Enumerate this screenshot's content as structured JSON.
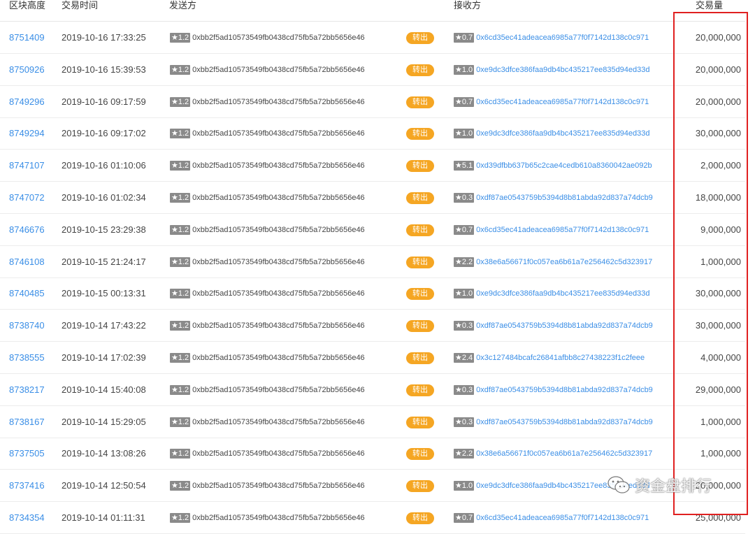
{
  "columns": {
    "height": "区块高度",
    "time": "交易时间",
    "from": "发送方",
    "to": "接收方",
    "amount": "交易量"
  },
  "rows": [
    {
      "height": "8751409",
      "time": "2019-10-16 17:33:25",
      "from_score": "★1.2",
      "from": "0xbb2f5ad10573549fb0438cd75fb5a72bb5656e46",
      "direction": "转出",
      "to_score": "★0.7",
      "to": "0x6cd35ec41adeacea6985a77f0f7142d138c0c971",
      "amount": "20,000,000"
    },
    {
      "height": "8750926",
      "time": "2019-10-16 15:39:53",
      "from_score": "★1.2",
      "from": "0xbb2f5ad10573549fb0438cd75fb5a72bb5656e46",
      "direction": "转出",
      "to_score": "★1.0",
      "to": "0xe9dc3dfce386faa9db4bc435217ee835d94ed33d",
      "amount": "20,000,000"
    },
    {
      "height": "8749296",
      "time": "2019-10-16 09:17:59",
      "from_score": "★1.2",
      "from": "0xbb2f5ad10573549fb0438cd75fb5a72bb5656e46",
      "direction": "转出",
      "to_score": "★0.7",
      "to": "0x6cd35ec41adeacea6985a77f0f7142d138c0c971",
      "amount": "20,000,000"
    },
    {
      "height": "8749294",
      "time": "2019-10-16 09:17:02",
      "from_score": "★1.2",
      "from": "0xbb2f5ad10573549fb0438cd75fb5a72bb5656e46",
      "direction": "转出",
      "to_score": "★1.0",
      "to": "0xe9dc3dfce386faa9db4bc435217ee835d94ed33d",
      "amount": "30,000,000"
    },
    {
      "height": "8747107",
      "time": "2019-10-16 01:10:06",
      "from_score": "★1.2",
      "from": "0xbb2f5ad10573549fb0438cd75fb5a72bb5656e46",
      "direction": "转出",
      "to_score": "★5.1",
      "to": "0xd39dfbb637b65c2cae4cedb610a8360042ae092b",
      "amount": "2,000,000"
    },
    {
      "height": "8747072",
      "time": "2019-10-16 01:02:34",
      "from_score": "★1.2",
      "from": "0xbb2f5ad10573549fb0438cd75fb5a72bb5656e46",
      "direction": "转出",
      "to_score": "★0.3",
      "to": "0xdf87ae0543759b5394d8b81abda92d837a74dcb9",
      "amount": "18,000,000"
    },
    {
      "height": "8746676",
      "time": "2019-10-15 23:29:38",
      "from_score": "★1.2",
      "from": "0xbb2f5ad10573549fb0438cd75fb5a72bb5656e46",
      "direction": "转出",
      "to_score": "★0.7",
      "to": "0x6cd35ec41adeacea6985a77f0f7142d138c0c971",
      "amount": "9,000,000"
    },
    {
      "height": "8746108",
      "time": "2019-10-15 21:24:17",
      "from_score": "★1.2",
      "from": "0xbb2f5ad10573549fb0438cd75fb5a72bb5656e46",
      "direction": "转出",
      "to_score": "★2.2",
      "to": "0x38e6a56671f0c057ea6b61a7e256462c5d323917",
      "amount": "1,000,000"
    },
    {
      "height": "8740485",
      "time": "2019-10-15 00:13:31",
      "from_score": "★1.2",
      "from": "0xbb2f5ad10573549fb0438cd75fb5a72bb5656e46",
      "direction": "转出",
      "to_score": "★1.0",
      "to": "0xe9dc3dfce386faa9db4bc435217ee835d94ed33d",
      "amount": "30,000,000"
    },
    {
      "height": "8738740",
      "time": "2019-10-14 17:43:22",
      "from_score": "★1.2",
      "from": "0xbb2f5ad10573549fb0438cd75fb5a72bb5656e46",
      "direction": "转出",
      "to_score": "★0.3",
      "to": "0xdf87ae0543759b5394d8b81abda92d837a74dcb9",
      "amount": "30,000,000"
    },
    {
      "height": "8738555",
      "time": "2019-10-14 17:02:39",
      "from_score": "★1.2",
      "from": "0xbb2f5ad10573549fb0438cd75fb5a72bb5656e46",
      "direction": "转出",
      "to_score": "★2.4",
      "to": "0x3c127484bcafc26841afbb8c27438223f1c2feee",
      "amount": "4,000,000"
    },
    {
      "height": "8738217",
      "time": "2019-10-14 15:40:08",
      "from_score": "★1.2",
      "from": "0xbb2f5ad10573549fb0438cd75fb5a72bb5656e46",
      "direction": "转出",
      "to_score": "★0.3",
      "to": "0xdf87ae0543759b5394d8b81abda92d837a74dcb9",
      "amount": "29,000,000"
    },
    {
      "height": "8738167",
      "time": "2019-10-14 15:29:05",
      "from_score": "★1.2",
      "from": "0xbb2f5ad10573549fb0438cd75fb5a72bb5656e46",
      "direction": "转出",
      "to_score": "★0.3",
      "to": "0xdf87ae0543759b5394d8b81abda92d837a74dcb9",
      "amount": "1,000,000"
    },
    {
      "height": "8737505",
      "time": "2019-10-14 13:08:26",
      "from_score": "★1.2",
      "from": "0xbb2f5ad10573549fb0438cd75fb5a72bb5656e46",
      "direction": "转出",
      "to_score": "★2.2",
      "to": "0x38e6a56671f0c057ea6b61a7e256462c5d323917",
      "amount": "1,000,000"
    },
    {
      "height": "8737416",
      "time": "2019-10-14 12:50:54",
      "from_score": "★1.2",
      "from": "0xbb2f5ad10573549fb0438cd75fb5a72bb5656e46",
      "direction": "转出",
      "to_score": "★1.0",
      "to": "0xe9dc3dfce386faa9db4bc435217ee835d94ed33d",
      "amount": "20,000,000"
    },
    {
      "height": "8734354",
      "time": "2019-10-14 01:11:31",
      "from_score": "★1.2",
      "from": "0xbb2f5ad10573549fb0438cd75fb5a72bb5656e46",
      "direction": "转出",
      "to_score": "★0.7",
      "to": "0x6cd35ec41adeacea6985a77f0f7142d138c0c971",
      "amount": "25,000,000"
    }
  ],
  "watermark": {
    "text": "资金盘排行",
    "icon": "wechat-icon"
  },
  "colors": {
    "link": "#3a8ee6",
    "direction_pill": "#f5a623",
    "score_badge": "#8a8a8a",
    "highlight_box": "#e02020"
  }
}
